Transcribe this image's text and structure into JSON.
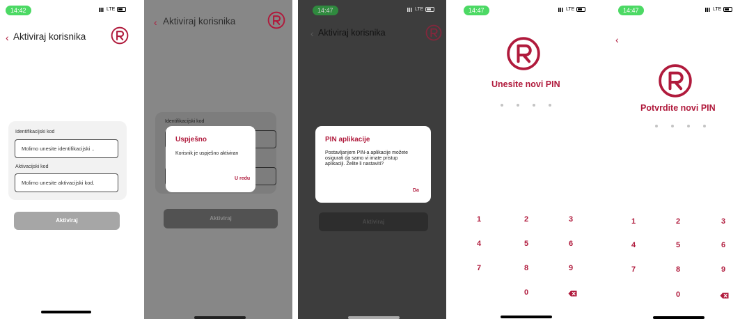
{
  "status": {
    "network": "LTE"
  },
  "brand": {
    "accent": "#b01a3c"
  },
  "screen1": {
    "time": "14:42",
    "back_label": "Aktiviraj korisnika",
    "id_label": "Identifikacijski kod",
    "id_placeholder": "Molimo unesite identifikacijski ..",
    "act_label": "Aktivacijski kod",
    "act_placeholder": "Molimo unesite aktivacijski kod.",
    "submit_label": "Aktiviraj"
  },
  "screen2": {
    "back_label": "Aktiviraj korisnika",
    "field_label_peek": "Identifikacijski kod",
    "dialog": {
      "title": "Uspješno",
      "message": "Korisnik je uspješno aktiviran",
      "ok": "U redu"
    },
    "submit_label": "Aktiviraj"
  },
  "screen3": {
    "time": "14:47",
    "back_label": "Aktiviraj korisnika",
    "dialog": {
      "title": "PIN aplikacije",
      "message_lines": [
        "Postavljanjem PIN-a aplikacije možete",
        "osigurati da samo vi imate pristup",
        "aplikaciji. Želite li nastaviti?"
      ],
      "ok": "Da"
    },
    "submit_label": "Aktiviraj"
  },
  "screen4": {
    "time": "14:47",
    "heading": "Unesite novi PIN",
    "keys": [
      "1",
      "2",
      "3",
      "4",
      "5",
      "6",
      "7",
      "8",
      "9",
      "0"
    ]
  },
  "screen5": {
    "time": "14:47",
    "heading": "Potvrdite novi PIN",
    "keys": [
      "1",
      "2",
      "3",
      "4",
      "5",
      "6",
      "7",
      "8",
      "9",
      "0"
    ]
  }
}
